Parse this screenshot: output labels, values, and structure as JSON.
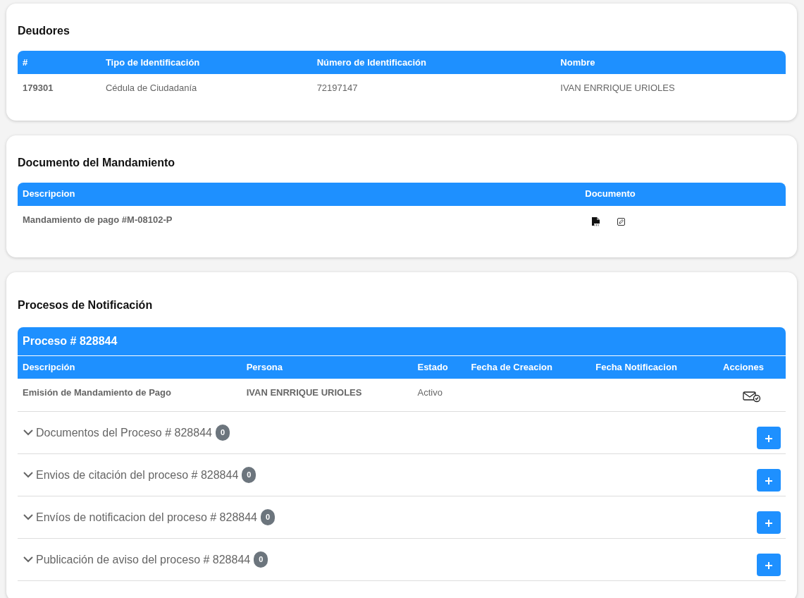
{
  "deudores": {
    "title": "Deudores",
    "columns": [
      "#",
      "Tipo de Identificación",
      "Número de Identificación",
      "Nombre"
    ],
    "rows": [
      [
        {
          "text": "179301",
          "bold": true
        },
        {
          "text": "Cédula de Ciudadanía",
          "bold": false
        },
        {
          "text": "72197147",
          "bold": false
        },
        {
          "text": "IVAN ENRRIQUE URIOLES",
          "bold": false
        }
      ]
    ]
  },
  "documento": {
    "title": "Documento del Mandamiento",
    "columns": [
      "Descripcion",
      "Documento"
    ],
    "rows": [
      [
        {
          "text": "Mandamiento de pago #M-08102-P",
          "bold": true
        }
      ]
    ]
  },
  "procesos": {
    "title": "Procesos de Notificación",
    "proceso": {
      "title": "Proceso # 828844",
      "columns": [
        "Descripción",
        "Persona",
        "Estado",
        "Fecha de Creacion",
        "Fecha Notificacion",
        "Acciones"
      ],
      "rows": [
        [
          {
            "text": "Emisión de Mandamiento de Pago",
            "bold": true
          },
          {
            "text": "IVAN ENRRIQUE URIOLES",
            "bold": true
          },
          {
            "text": "Activo",
            "bold": false
          }
        ]
      ]
    },
    "sections": [
      {
        "title": "Documentos del Proceso # 828844",
        "count": "0",
        "expanded": false
      },
      {
        "title": "Envios de citación del proceso # 828844",
        "count": "0",
        "expanded": false
      },
      {
        "title": "Envíos de notificacion del proceso # 828844",
        "count": "0",
        "expanded": false
      },
      {
        "title": "Publicación de aviso del proceso # 828844",
        "count": "0",
        "expanded": false
      }
    ]
  }
}
